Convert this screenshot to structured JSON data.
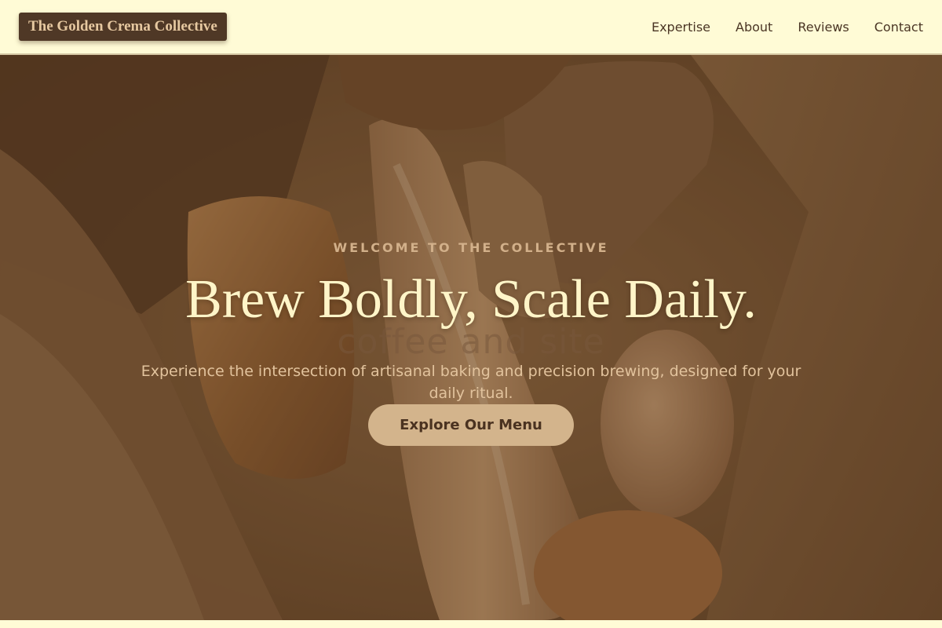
{
  "brand": {
    "name": "The Golden Crema Collective"
  },
  "nav": {
    "items": [
      {
        "label": "Expertise"
      },
      {
        "label": "About"
      },
      {
        "label": "Reviews"
      },
      {
        "label": "Contact"
      }
    ]
  },
  "hero": {
    "eyebrow": "WELCOME TO THE COLLECTIVE",
    "headline": "Brew Boldly, Scale Daily.",
    "watermark": "coffee and site",
    "subtext": "Experience the intersection of artisanal baking and precision brewing, designed for your daily ritual.",
    "cta_label": "Explore Our Menu",
    "background_image": "bread-loaves-in-paper-bag"
  },
  "colors": {
    "header_bg": "#fffbd6",
    "logo_bg": "#4f3826",
    "logo_text": "#e6c8a0",
    "nav_text": "#4a3524",
    "headline": "#fff5c8",
    "eyebrow": "#d2b08a",
    "cta_bg": "#d3b48c",
    "cta_text": "#4a3220"
  }
}
